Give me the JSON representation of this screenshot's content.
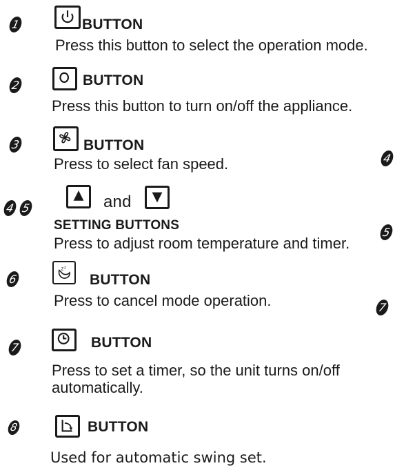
{
  "items": [
    {
      "number": "1",
      "title": "BUTTON",
      "icon": "power-icon",
      "description": "Press this button to select the operation mode."
    },
    {
      "number": "2",
      "title": "BUTTON",
      "icon": "circle-icon",
      "description": "Press this button to turn on/off the appliance."
    },
    {
      "number": "3",
      "title": "BUTTON",
      "icon": "fan-icon",
      "description": "Press to select fan speed."
    },
    {
      "numbers": [
        "4",
        "5"
      ],
      "connector": "and",
      "title": "SETTING BUTTONS",
      "icons": [
        "up-arrow-icon",
        "down-arrow-icon"
      ],
      "description": "Press to adjust room temperature and timer."
    },
    {
      "number": "6",
      "title": "BUTTON",
      "icon": "sleep-icon",
      "description": "Press to cancel mode operation."
    },
    {
      "number": "7",
      "title": "BUTTON",
      "icon": "clock-icon",
      "description": "Press to set a timer, so the unit turns on/off automatically."
    },
    {
      "number": "8",
      "title": "BUTTON",
      "icon": "swing-icon",
      "description": "Used for automatic swing set."
    }
  ],
  "right_edge_numbers": [
    "4",
    "5",
    "7"
  ]
}
